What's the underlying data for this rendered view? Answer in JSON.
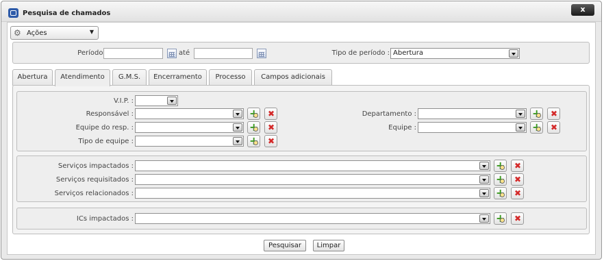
{
  "window": {
    "title": "Pesquisa de chamados",
    "close_label": "x"
  },
  "actions": {
    "label": "Ações"
  },
  "period": {
    "label": "Período :",
    "separator": "até",
    "type_label": "Tipo de período :",
    "type_value": "Abertura"
  },
  "tabs": [
    {
      "label": "Abertura"
    },
    {
      "label": "Atendimento",
      "active": true
    },
    {
      "label": "G.M.S."
    },
    {
      "label": "Encerramento"
    },
    {
      "label": "Processo"
    },
    {
      "label": "Campos adicionais"
    }
  ],
  "fields": {
    "vip": "V.I.P. :",
    "responsavel": "Responsável :",
    "equipe_resp": "Equipe do resp. :",
    "tipo_equipe": "Tipo de equipe :",
    "departamento": "Departamento :",
    "equipe": "Equipe :",
    "servicos_impactados": "Serviços impactados :",
    "servicos_requisitados": "Serviços requisitados :",
    "servicos_relacionados": "Serviços relacionados :",
    "ics_impactados": "ICs impactados :"
  },
  "buttons": {
    "search": "Pesquisar",
    "clear": "Limpar"
  }
}
